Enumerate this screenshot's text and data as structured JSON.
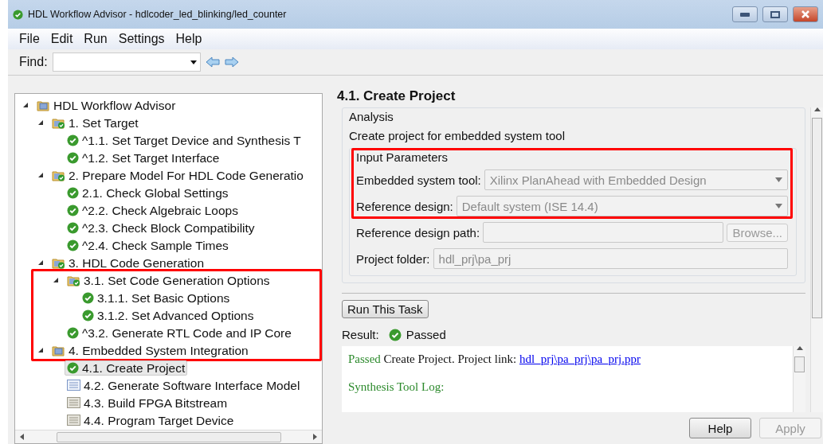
{
  "window": {
    "title": "HDL Workflow Advisor - hdlcoder_led_blinking/led_counter"
  },
  "menu": [
    "File",
    "Edit",
    "Run",
    "Settings",
    "Help"
  ],
  "find": {
    "label": "Find:"
  },
  "tree": [
    {
      "label": "HDL Workflow Advisor",
      "kind": "folder",
      "expanded": true,
      "selected": false,
      "highlighted": false,
      "children": [
        {
          "label": "1. Set Target",
          "kind": "passed_folder",
          "expanded": true,
          "selected": false,
          "highlighted": false,
          "children": [
            {
              "label": "^1.1. Set Target Device and Synthesis T",
              "kind": "passed",
              "selected": false,
              "highlighted": false
            },
            {
              "label": "^1.2. Set Target Interface",
              "kind": "passed",
              "selected": false,
              "highlighted": false
            }
          ]
        },
        {
          "label": "2. Prepare Model For HDL Code Generatio",
          "kind": "passed_folder",
          "expanded": true,
          "selected": false,
          "highlighted": false,
          "children": [
            {
              "label": "2.1. Check Global Settings",
              "kind": "passed",
              "selected": false,
              "highlighted": false
            },
            {
              "label": "^2.2. Check Algebraic Loops",
              "kind": "passed",
              "selected": false,
              "highlighted": false
            },
            {
              "label": "^2.3. Check Block Compatibility",
              "kind": "passed",
              "selected": false,
              "highlighted": false
            },
            {
              "label": "^2.4. Check Sample Times",
              "kind": "passed",
              "selected": false,
              "highlighted": false
            }
          ]
        },
        {
          "label": "3. HDL Code Generation",
          "kind": "passed_folder",
          "expanded": true,
          "selected": false,
          "highlighted": false,
          "children": [
            {
              "label": "3.1. Set Code Generation Options",
              "kind": "passed_folder",
              "expanded": true,
              "selected": false,
              "highlighted": true,
              "children": [
                {
                  "label": "3.1.1. Set Basic Options",
                  "kind": "passed",
                  "selected": false,
                  "highlighted": true
                },
                {
                  "label": "3.1.2. Set Advanced Options",
                  "kind": "passed",
                  "selected": false,
                  "highlighted": true
                }
              ]
            },
            {
              "label": "^3.2. Generate RTL Code and IP Core",
              "kind": "passed",
              "selected": false,
              "highlighted": true
            }
          ]
        },
        {
          "label": "4. Embedded System Integration",
          "kind": "folder",
          "expanded": true,
          "selected": false,
          "highlighted": true,
          "children": [
            {
              "label": "4.1. Create Project",
              "kind": "passed",
              "selected": true,
              "highlighted": false
            },
            {
              "label": "4.2. Generate Software Interface Model",
              "kind": "task",
              "selected": false,
              "highlighted": false
            },
            {
              "label": "4.3. Build FPGA Bitstream",
              "kind": "pending_task",
              "selected": false,
              "highlighted": false
            },
            {
              "label": "4.4. Program Target Device",
              "kind": "pending_task",
              "selected": false,
              "highlighted": false
            }
          ]
        }
      ]
    }
  ],
  "task": {
    "title": "4.1. Create Project",
    "analysis": {
      "legend": "Analysis",
      "description": "Create project for embedded system tool",
      "input_parameters": {
        "legend": "Input Parameters",
        "fields": [
          {
            "kind": "combo",
            "label": "Embedded system tool:",
            "value": "Xilinx PlanAhead with Embedded Design",
            "disabled": true,
            "highlighted": true
          },
          {
            "kind": "combo",
            "label": "Reference design:",
            "value": "Default system (ISE 14.4)",
            "disabled": true,
            "highlighted": true
          },
          {
            "kind": "path",
            "label": "Reference design path:",
            "button": "Browse...",
            "disabled": true,
            "highlighted": false
          },
          {
            "kind": "text",
            "label": "Project folder:",
            "value": "hdl_prj\\pa_prj",
            "disabled": true,
            "highlighted": false
          }
        ]
      }
    },
    "run_button": "Run This Task",
    "result": {
      "label": "Result:",
      "status": "Passed"
    },
    "log": [
      {
        "status": "Passed",
        "text": " Create Project. Project link: ",
        "link": "hdl_prj\\pa_prj\\pa_prj.ppr"
      },
      {
        "status": "Synthesis Tool Log:"
      }
    ]
  },
  "buttons": [
    {
      "label": "Help",
      "disabled": false
    },
    {
      "label": "Apply",
      "disabled": true
    }
  ]
}
